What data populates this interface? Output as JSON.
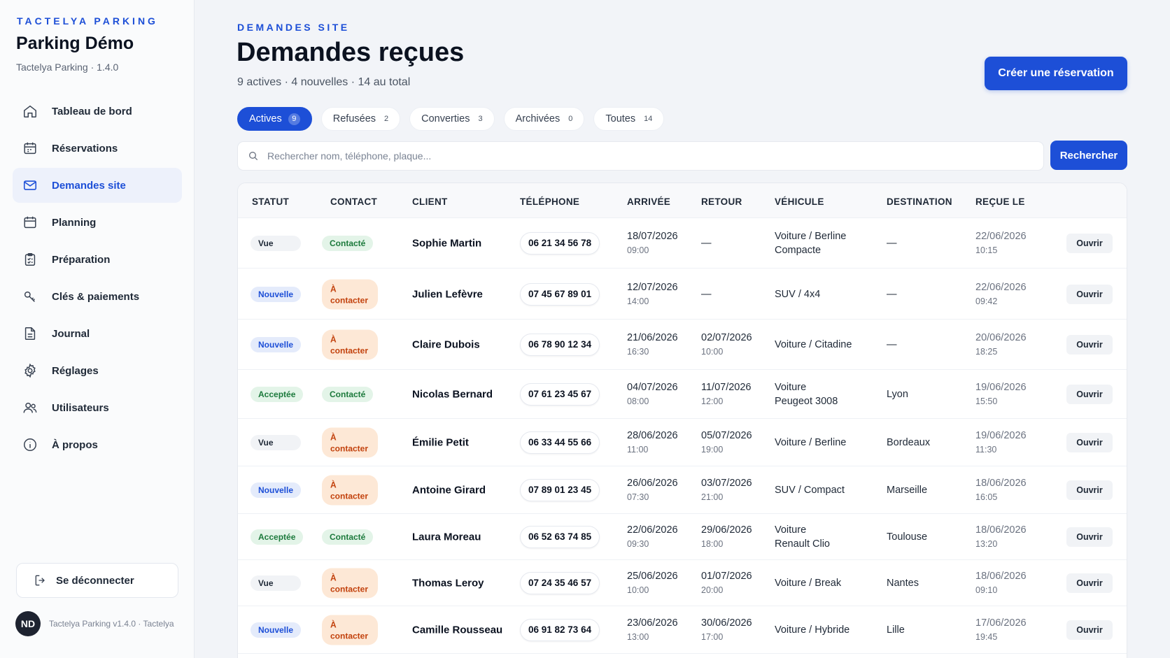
{
  "app": {
    "eyebrow": "TACTELYA PARKING",
    "title": "Parking Démo",
    "version": "Tactelya Parking · 1.4.0"
  },
  "sidebar": {
    "items": [
      {
        "label": "Tableau de bord",
        "icon": "home-icon"
      },
      {
        "label": "Réservations",
        "icon": "calendar-grid-icon"
      },
      {
        "label": "Demandes site",
        "icon": "mail-icon",
        "active": true
      },
      {
        "label": "Planning",
        "icon": "calendar-icon"
      },
      {
        "label": "Préparation",
        "icon": "clipboard-icon"
      },
      {
        "label": "Clés & paiements",
        "icon": "key-icon"
      },
      {
        "label": "Journal",
        "icon": "document-icon"
      },
      {
        "label": "Réglages",
        "icon": "gear-icon"
      },
      {
        "label": "Utilisateurs",
        "icon": "users-icon"
      },
      {
        "label": "À propos",
        "icon": "info-icon"
      }
    ],
    "logout_label": "Se déconnecter",
    "user_initials": "ND",
    "footer_text": "Tactelya Parking v1.4.0 · Tactelya"
  },
  "header": {
    "eyebrow": "DEMANDES SITE",
    "title": "Demandes reçues",
    "summary": "9 actives · 4 nouvelles · 14 au total",
    "create_label": "Créer une réservation"
  },
  "tabs": [
    {
      "label": "Actives",
      "count": "9",
      "active": true
    },
    {
      "label": "Refusées",
      "count": "2"
    },
    {
      "label": "Converties",
      "count": "3"
    },
    {
      "label": "Archivées",
      "count": "0"
    },
    {
      "label": "Toutes",
      "count": "14"
    }
  ],
  "search": {
    "placeholder": "Rechercher nom, téléphone, plaque...",
    "value": "",
    "button_label": "Rechercher"
  },
  "table": {
    "headers": {
      "statut": "STATUT",
      "contact": "CONTACT",
      "client": "CLIENT",
      "telephone": "TÉLÉPHONE",
      "arrivee": "ARRIVÉE",
      "retour": "RETOUR",
      "vehicule": "VÉHICULE",
      "destination": "DESTINATION",
      "recue": "REÇUE LE"
    },
    "open_label": "Ouvrir",
    "rows": [
      {
        "statut": "Vue",
        "statut_type": "vue",
        "contact": "Contacté",
        "contact_type": "contacte",
        "client": "Sophie Martin",
        "phone": "06 21 34 56 78",
        "arr_date": "18/07/2026",
        "arr_time": "09:00",
        "ret_date": "—",
        "ret_time": "",
        "veh1": "Voiture / Berline",
        "veh2": "Compacte",
        "dest": "—",
        "rec_date": "22/06/2026",
        "rec_time": "10:15"
      },
      {
        "statut": "Nouvelle",
        "statut_type": "nouvelle",
        "contact": "À contacter",
        "contact_type": "acontacter",
        "client": "Julien Lefèvre",
        "phone": "07 45 67 89 01",
        "arr_date": "12/07/2026",
        "arr_time": "14:00",
        "ret_date": "—",
        "ret_time": "",
        "veh1": "SUV / 4x4",
        "veh2": "",
        "dest": "—",
        "rec_date": "22/06/2026",
        "rec_time": "09:42"
      },
      {
        "statut": "Nouvelle",
        "statut_type": "nouvelle",
        "contact": "À contacter",
        "contact_type": "acontacter",
        "client": "Claire Dubois",
        "phone": "06 78 90 12 34",
        "arr_date": "21/06/2026",
        "arr_time": "16:30",
        "ret_date": "02/07/2026",
        "ret_time": "10:00",
        "veh1": "Voiture / Citadine",
        "veh2": "",
        "dest": "—",
        "rec_date": "20/06/2026",
        "rec_time": "18:25"
      },
      {
        "statut": "Acceptée",
        "statut_type": "acceptee",
        "contact": "Contacté",
        "contact_type": "contacte",
        "client": "Nicolas Bernard",
        "phone": "07 61 23 45 67",
        "arr_date": "04/07/2026",
        "arr_time": "08:00",
        "ret_date": "11/07/2026",
        "ret_time": "12:00",
        "veh1": "Voiture",
        "veh2": "Peugeot 3008",
        "dest": "Lyon",
        "rec_date": "19/06/2026",
        "rec_time": "15:50"
      },
      {
        "statut": "Vue",
        "statut_type": "vue",
        "contact": "À contacter",
        "contact_type": "acontacter",
        "client": "Émilie Petit",
        "phone": "06 33 44 55 66",
        "arr_date": "28/06/2026",
        "arr_time": "11:00",
        "ret_date": "05/07/2026",
        "ret_time": "19:00",
        "veh1": "Voiture / Berline",
        "veh2": "",
        "dest": "Bordeaux",
        "rec_date": "19/06/2026",
        "rec_time": "11:30"
      },
      {
        "statut": "Nouvelle",
        "statut_type": "nouvelle",
        "contact": "À contacter",
        "contact_type": "acontacter",
        "client": "Antoine Girard",
        "phone": "07 89 01 23 45",
        "arr_date": "26/06/2026",
        "arr_time": "07:30",
        "ret_date": "03/07/2026",
        "ret_time": "21:00",
        "veh1": "SUV / Compact",
        "veh2": "",
        "dest": "Marseille",
        "rec_date": "18/06/2026",
        "rec_time": "16:05"
      },
      {
        "statut": "Acceptée",
        "statut_type": "acceptee",
        "contact": "Contacté",
        "contact_type": "contacte",
        "client": "Laura Moreau",
        "phone": "06 52 63 74 85",
        "arr_date": "22/06/2026",
        "arr_time": "09:30",
        "ret_date": "29/06/2026",
        "ret_time": "18:00",
        "veh1": "Voiture",
        "veh2": "Renault Clio",
        "dest": "Toulouse",
        "rec_date": "18/06/2026",
        "rec_time": "13:20"
      },
      {
        "statut": "Vue",
        "statut_type": "vue",
        "contact": "À contacter",
        "contact_type": "acontacter",
        "client": "Thomas Leroy",
        "phone": "07 24 35 46 57",
        "arr_date": "25/06/2026",
        "arr_time": "10:00",
        "ret_date": "01/07/2026",
        "ret_time": "20:00",
        "veh1": "Voiture / Break",
        "veh2": "",
        "dest": "Nantes",
        "rec_date": "18/06/2026",
        "rec_time": "09:10"
      },
      {
        "statut": "Nouvelle",
        "statut_type": "nouvelle",
        "contact": "À contacter",
        "contact_type": "acontacter",
        "client": "Camille Rousseau",
        "phone": "06 91 82 73 64",
        "arr_date": "23/06/2026",
        "arr_time": "13:00",
        "ret_date": "30/06/2026",
        "ret_time": "17:00",
        "veh1": "Voiture / Hybride",
        "veh2": "",
        "dest": "Lille",
        "rec_date": "17/06/2026",
        "rec_time": "19:45"
      }
    ]
  },
  "colors": {
    "accent": "#1d4fd7",
    "success": "#1c7a3c",
    "warning": "#c2410c"
  }
}
